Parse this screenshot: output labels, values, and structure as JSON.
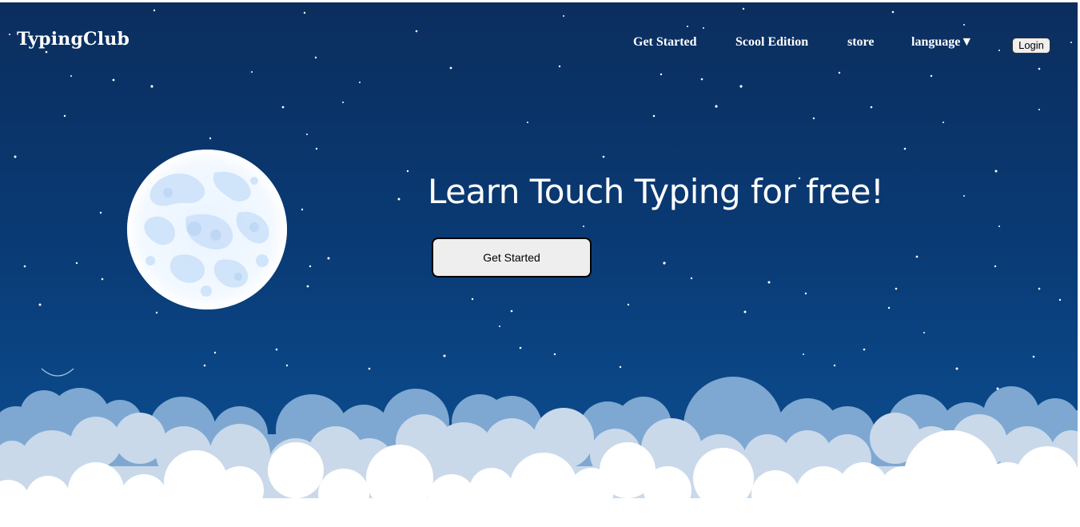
{
  "header": {
    "brand": "TypingClub",
    "nav": {
      "get_started": "Get Started",
      "school_edition": "Scool Edition",
      "store": "store",
      "language": "language▼"
    },
    "login_label": "Login"
  },
  "hero": {
    "headline": "Learn Touch Typing for free!",
    "cta_label": "Get Started"
  },
  "colors": {
    "sky_top": "#0b2e5e",
    "sky_bottom": "#0d4f92",
    "cloud_back": "#7fa8d0",
    "cloud_mid": "#c9d9ea",
    "cloud_front": "#ffffff",
    "moon": "#f4f9ff"
  },
  "icons": {
    "moon": "moon-illustration",
    "clouds": "cloud-bank-illustration",
    "stars": "starfield-decoration"
  }
}
